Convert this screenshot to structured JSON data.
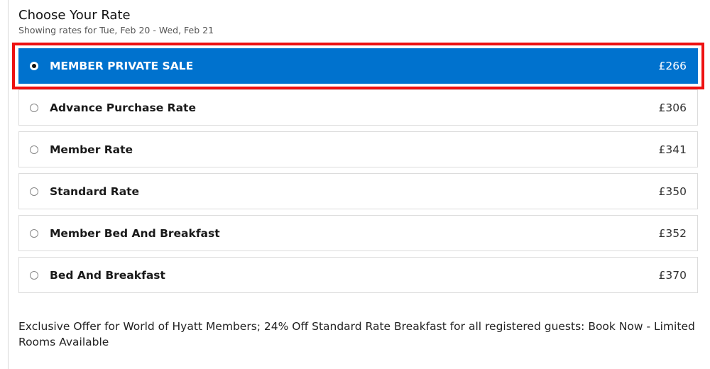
{
  "header": {
    "title": "Choose Your Rate",
    "subtitle": "Showing rates for Tue, Feb 20 - Wed, Feb 21"
  },
  "rates": [
    {
      "name": "MEMBER PRIVATE SALE",
      "price": "£266",
      "selected": true
    },
    {
      "name": "Advance Purchase Rate",
      "price": "£306",
      "selected": false
    },
    {
      "name": "Member Rate",
      "price": "£341",
      "selected": false
    },
    {
      "name": "Standard Rate",
      "price": "£350",
      "selected": false
    },
    {
      "name": "Member Bed And Breakfast",
      "price": "£352",
      "selected": false
    },
    {
      "name": "Bed And Breakfast",
      "price": "£370",
      "selected": false
    }
  ],
  "offer": {
    "text": "Exclusive Offer for World of Hyatt Members; 24% Off Standard Rate Breakfast for all registered guests: Book Now - Limited Rooms Available"
  },
  "colors": {
    "selected_background": "#0072ce",
    "highlight_outline": "#ee1111"
  }
}
